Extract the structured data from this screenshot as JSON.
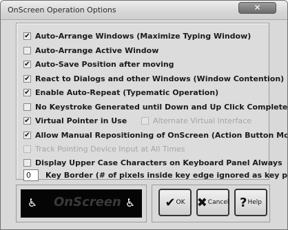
{
  "window": {
    "title": "OnScreen Operation Options",
    "close_glyph": "✕"
  },
  "options": [
    {
      "label": "Auto-Arrange Windows (Maximize Typing Window)",
      "checked": true,
      "enabled": true
    },
    {
      "label": "Auto-Arrange Active Window",
      "checked": false,
      "enabled": true
    },
    {
      "label": "Auto-Save Position after moving",
      "checked": true,
      "enabled": true
    },
    {
      "label": "React to Dialogs and other Windows (Window Contention)",
      "checked": true,
      "enabled": true
    },
    {
      "label": "Enable Auto-Repeat (Typematic Operation)",
      "checked": true,
      "enabled": true
    },
    {
      "label": "No Keystroke Generated until Down and Up Click Completed",
      "checked": false,
      "enabled": true
    },
    {
      "label": "Virtual Pointer in Use",
      "checked": true,
      "enabled": true
    },
    {
      "label": "Alternate Virtual Interface",
      "checked": false,
      "enabled": false
    },
    {
      "label": "Allow Manual Repositioning of OnScreen (Action Button Move)",
      "checked": true,
      "enabled": true
    },
    {
      "label": "Track Pointing Device Input at All Times",
      "checked": false,
      "enabled": false
    },
    {
      "label": "Display Upper Case Characters on Keyboard Panel Always",
      "checked": false,
      "enabled": true
    }
  ],
  "key_border": {
    "value": "0",
    "label": "Key Border (# of pixels inside key edge ignored as key press)"
  },
  "logo": {
    "text": "OnScreen",
    "icon": "accessibility-wheelchair-icon"
  },
  "buttons": {
    "ok_label": "OK",
    "cancel_label": "Cancel",
    "help_label": "Help"
  },
  "colors": {
    "window_bg": "#d9d9d9",
    "disabled_text": "#a5a5a5"
  }
}
